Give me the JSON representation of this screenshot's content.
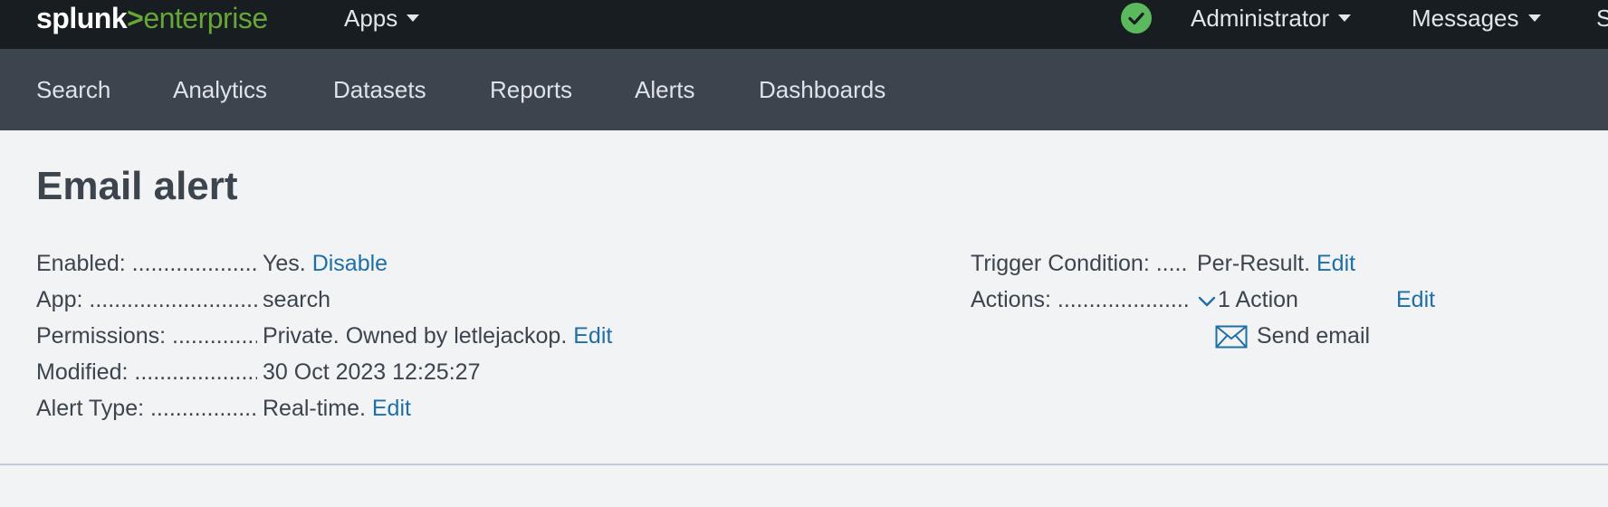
{
  "topbar": {
    "logo": {
      "part1": "splunk",
      "part2": ">",
      "part3": "enterprise"
    },
    "apps_label": "Apps",
    "status_icon": "check-circle-icon",
    "admin_label": "Administrator",
    "messages_label": "Messages",
    "cut_label": "S"
  },
  "nav": {
    "items": [
      "Search",
      "Analytics",
      "Datasets",
      "Reports",
      "Alerts",
      "Dashboards"
    ]
  },
  "page": {
    "title": "Email alert",
    "left": {
      "enabled_label": "Enabled: ..................................",
      "enabled_value": "Yes.",
      "enabled_link": "Disable",
      "app_label": "App: ..........................................",
      "app_value": "search",
      "permissions_label": "Permissions: ..............................",
      "permissions_value": "Private. Owned by letlejackop.",
      "permissions_link": "Edit",
      "modified_label": "Modified: ..................................",
      "modified_value": "30 Oct 2023 12:25:27",
      "alert_type_label": "Alert Type: ..............................",
      "alert_type_value": "Real-time.",
      "alert_type_link": "Edit"
    },
    "right": {
      "trigger_label": "Trigger Condition: ...........",
      "trigger_value": "Per-Result.",
      "trigger_link": "Edit",
      "actions_label": "Actions: ......................................",
      "actions_count": "1 Action",
      "actions_link": "Edit",
      "action_item": "Send email"
    }
  },
  "colors": {
    "topbar": "#171d21",
    "appbar": "#3c444d",
    "link": "#1e6fa6",
    "brand_green": "#65a637",
    "status_green": "#5cb85c"
  }
}
